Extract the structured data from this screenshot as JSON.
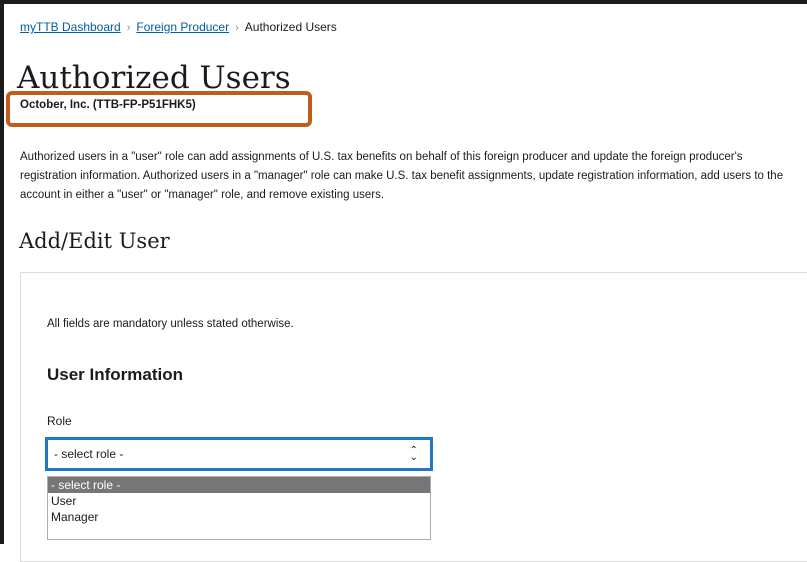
{
  "breadcrumb": {
    "items": [
      "myTTB Dashboard",
      "Foreign Producer",
      "Authorized Users"
    ]
  },
  "page": {
    "title": "Authorized Users",
    "subtitle": "October, Inc. (TTB-FP-P51FHK5)",
    "intro": "Authorized users in a \"user\" role can add assignments of U.S. tax benefits on behalf of this foreign producer and update the foreign producer's registration information. Authorized users in a \"manager\" role can make U.S. tax benefit assignments, update registration information, add users to the account in either a \"user\" or \"manager\" role, and remove existing users.",
    "section_title": "Add/Edit User"
  },
  "form": {
    "mandatory_note": "All fields are mandatory unless stated otherwise.",
    "section_heading": "User Information",
    "role_label": "Role",
    "role_selected": "- select role -",
    "role_options": [
      "- select role -",
      "User",
      "Manager"
    ]
  },
  "colors": {
    "highlight": "#c05d1c",
    "focus": "#2378c3",
    "link": "#005ea2",
    "selected_option": "#767676"
  },
  "icons": {
    "separator": "chevron-right-icon",
    "select": "up-down-chevron-icon"
  }
}
